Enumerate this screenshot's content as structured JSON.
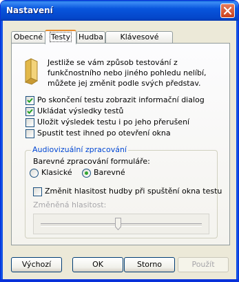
{
  "window": {
    "title": "Nastavení"
  },
  "tabs": [
    {
      "label": "Obecné",
      "active": false
    },
    {
      "label": "Testy",
      "active": true
    },
    {
      "label": "Hudba",
      "active": false
    },
    {
      "label": "Klávesové zkratky",
      "active": false
    }
  ],
  "panel": {
    "intro_text": "Jestliže se vám způsob testování z funkčnostního nebo jiného pohledu nelíbí, můžete jej změnit podle svých představ.",
    "options": [
      {
        "label": "Po skončení testu zobrazit informační dialog",
        "checked": true
      },
      {
        "label": "Ukládat výsledky testů",
        "checked": true
      },
      {
        "label": "Uložit výsledek testu i po jeho přerušení",
        "checked": false
      },
      {
        "label": "Spustit test ihned po otevření okna",
        "checked": false
      }
    ],
    "av_group": {
      "title": "Audiovizuální zpracování",
      "form_processing_label": "Barevné zpracování formuláře:",
      "radio_classic": "Klasické",
      "radio_color": "Barevné",
      "selected": "Barevné",
      "change_volume_label": "Změnit hlasitost hudby při spuštění okna testu",
      "change_volume_checked": false,
      "volume_label": "Změněná hlasitost:",
      "volume_level_percent": 50
    }
  },
  "buttons": {
    "default": "Výchozí",
    "ok": "OK",
    "cancel": "Storno",
    "apply": "Použít"
  },
  "colors": {
    "titlebar": "#0855dd",
    "dialog_bg": "#ece9d8",
    "group_title": "#0046d5",
    "check": "#21a121",
    "tab_highlight": "#e68b2c"
  }
}
